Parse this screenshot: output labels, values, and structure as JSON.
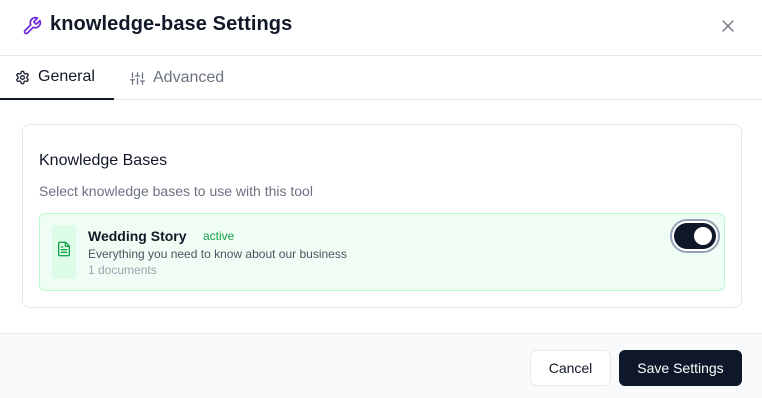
{
  "dialog": {
    "title": "knowledge-base Settings",
    "title_icon": "wrench-icon",
    "close_icon": "close-icon"
  },
  "tabs": [
    {
      "label": "General",
      "icon": "settings-gear-icon",
      "active": true
    },
    {
      "label": "Advanced",
      "icon": "sliders-icon",
      "active": false
    }
  ],
  "knowledge_bases": {
    "heading": "Knowledge Bases",
    "subtitle": "Select knowledge bases to use with this tool",
    "items": [
      {
        "name": "Wedding Story",
        "status": "active",
        "description": "Everything you need to know about our business",
        "count": "1 documents",
        "icon": "document-icon",
        "enabled": true
      }
    ]
  },
  "footer": {
    "cancel_label": "Cancel",
    "save_label": "Save Settings"
  },
  "colors": {
    "accent_dark": "#0f172a",
    "wrench_icon": "#6d28d9",
    "active_green": "#16a34a",
    "item_bg": "#f0fdf4",
    "item_border": "#bbf7d0"
  }
}
